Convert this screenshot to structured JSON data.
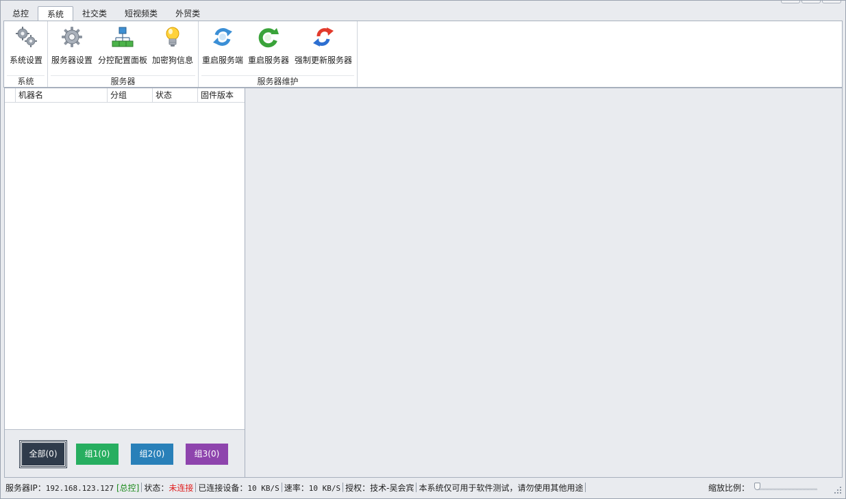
{
  "tabs": [
    "总控",
    "系统",
    "社交类",
    "短视频类",
    "外贸类"
  ],
  "active_tab": "系统",
  "ribbon": {
    "groups": [
      {
        "label": "系统",
        "buttons": [
          {
            "label": "系统设置",
            "icon": "gears-icon"
          }
        ]
      },
      {
        "label": "服务器",
        "buttons": [
          {
            "label": "服务器设置",
            "icon": "gear-icon"
          },
          {
            "label": "分控配置面板",
            "icon": "network-tree-icon"
          },
          {
            "label": "加密狗信息",
            "icon": "lightbulb-icon"
          }
        ]
      },
      {
        "label": "服务器维护",
        "buttons": [
          {
            "label": "重启服务端",
            "icon": "refresh-icon"
          },
          {
            "label": "重启服务器",
            "icon": "restart-icon"
          },
          {
            "label": "强制更新服务器",
            "icon": "force-update-icon"
          }
        ]
      }
    ]
  },
  "list": {
    "columns": [
      "",
      "机器名",
      "分组",
      "状态",
      "固件版本"
    ]
  },
  "group_buttons": [
    {
      "label": "全部(0)",
      "color": "#2f3b4b"
    },
    {
      "label": "组1(0)",
      "color": "#27ae60"
    },
    {
      "label": "组2(0)",
      "color": "#2980b9"
    },
    {
      "label": "组3(0)",
      "color": "#8e44ad"
    }
  ],
  "status": {
    "server_ip_label": "服务器IP：",
    "server_ip": "192.168.123.127",
    "role": "[总控]",
    "state_label": "状态：",
    "state_value": "未连接",
    "devices_label": "已连接设备：",
    "devices_value": "10 KB/S",
    "rate_label": "速率：",
    "rate_value": "10 KB/S",
    "license": "授权：技术-吴会宾",
    "notice": "本系统仅可用于软件测试，请勿使用其他用途",
    "zoom_label": "缩放比例："
  },
  "colors": {
    "role_green": "#1a8a1a",
    "state_red": "#e02020"
  }
}
